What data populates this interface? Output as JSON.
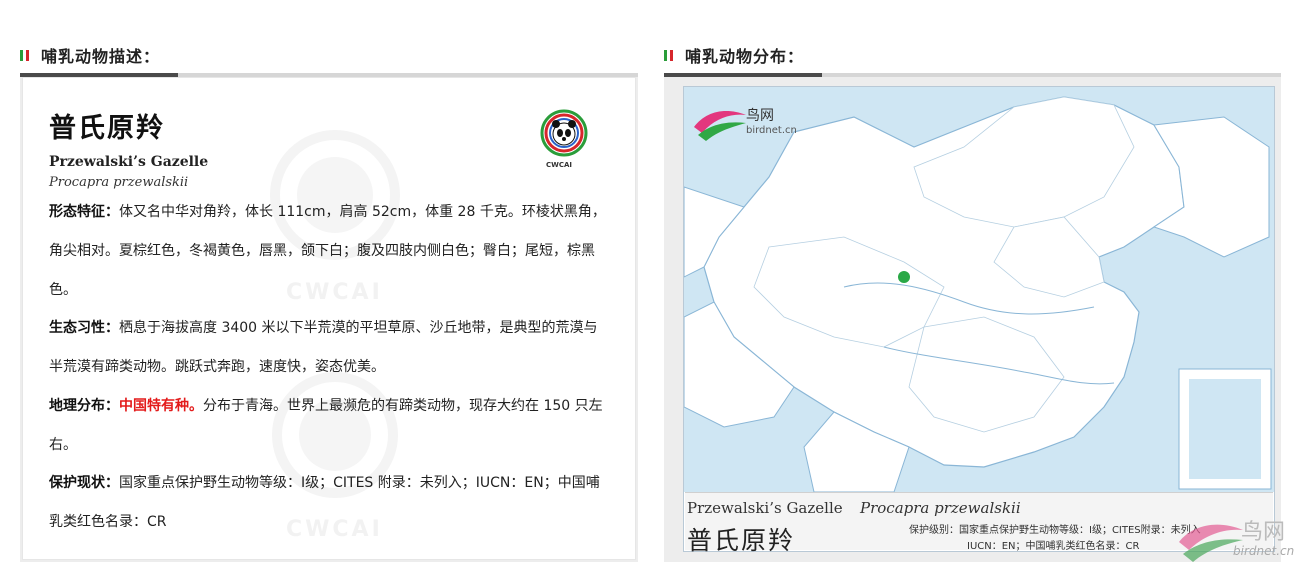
{
  "left_section": {
    "title": "哺乳动物描述：",
    "species_cn": "普氏原羚",
    "species_en": "Przewalski’s Gazelle",
    "species_latin": "Procapra przewalskii",
    "logo_text": "CWCAI",
    "watermark_text": "CWCAI",
    "morphology_label": "形态特征：",
    "morphology_text": "体又名中华对角羚，体长 111cm，肩高 52cm，体重 28 千克。环棱状黑角，角尖相对。夏棕红色，冬褐黄色，唇黑，颌下白；腹及四肢内侧白色；臀白；尾短，棕黑色。",
    "ecology_label": "生态习性：",
    "ecology_text": "栖息于海拔高度 3400 米以下半荒漠的平坦草原、沙丘地带，是典型的荒漠与半荒漠有蹄类动物。跳跃式奔跑，速度快，姿态优美。",
    "distribution_label": "地理分布：",
    "distribution_highlight": "中国特有种。",
    "distribution_text": "分布于青海。世界上最濒危的有蹄类动物，现存大约在 150 只左右。",
    "protection_label": "保护现状：",
    "protection_text": "国家重点保护野生动物等级：Ⅰ级；CITES 附录：未列入；IUCN：EN；中国哺乳类红色名录：CR"
  },
  "right_section": {
    "title": "哺乳动物分布：",
    "map_logo_name": "鸟网",
    "map_logo_domain": "birdnet.cn",
    "map_en": "Przewalski’s Gazelle",
    "map_latin": "Procapra przewalskii",
    "map_cn": "普氏原羚",
    "map_status_line1": "保护级别：国家重点保护野生动物等级：Ⅰ级；CITES附录：未列入",
    "map_status_line2": "IUCN：EN；中国哺乳类红色名录：CR",
    "corner_logo_name": "鸟网",
    "corner_logo_domain": "birdnet.cn"
  },
  "colors": {
    "flag_green": "#2a9d3a",
    "flag_red": "#d6262b",
    "highlight_red": "#e31b1b",
    "map_water": "#cfe6f3",
    "range_dot": "#2aa846"
  }
}
